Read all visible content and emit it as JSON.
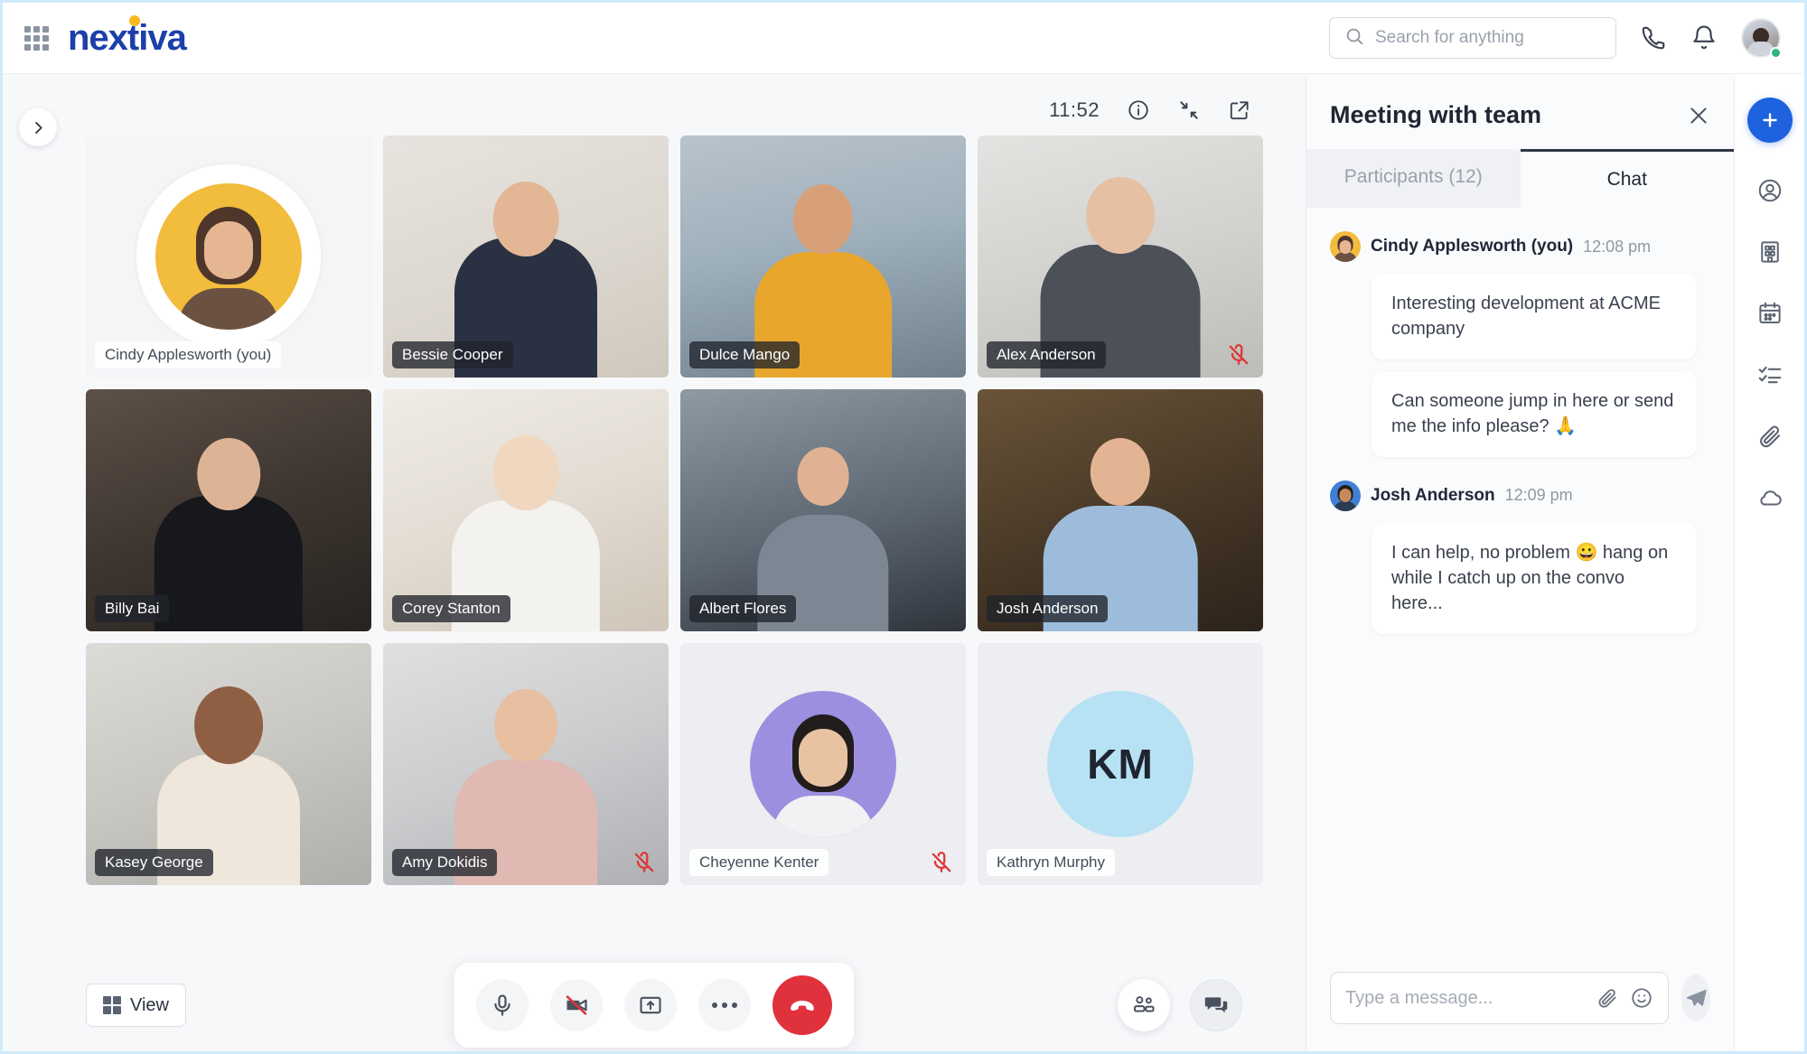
{
  "topbar": {
    "logo_text": "nextiva",
    "apps_icon": "grid-apps-icon",
    "search": {
      "placeholder": "Search for anything",
      "value": "",
      "icon": "search-icon"
    },
    "phone_icon": "phone-icon",
    "bell_icon": "bell-notification-icon",
    "avatar": {
      "name": "avatar",
      "status": "online"
    }
  },
  "stage": {
    "collapse_icon": "chevron-right-icon",
    "timer": "11:52",
    "info_icon": "info-circle-icon",
    "minimize_icon": "minimize-diagonal-icon",
    "popout_icon": "open-external-icon",
    "participants": [
      {
        "name": "Cindy Applesworth (you)",
        "kind": "self-avatar",
        "avatar_color": "#f2bc3d",
        "muted": false,
        "label_style": "light"
      },
      {
        "name": "Bessie Cooper",
        "kind": "video",
        "muted": false,
        "label_style": "dark"
      },
      {
        "name": "Dulce Mango",
        "kind": "video",
        "muted": false,
        "label_style": "dark"
      },
      {
        "name": "Alex Anderson",
        "kind": "video",
        "muted": true,
        "label_style": "dark"
      },
      {
        "name": "Billy Bai",
        "kind": "video",
        "muted": false,
        "label_style": "dark"
      },
      {
        "name": "Corey Stanton",
        "kind": "video",
        "muted": false,
        "label_style": "dark"
      },
      {
        "name": "Albert Flores",
        "kind": "video",
        "muted": false,
        "label_style": "dark"
      },
      {
        "name": "Josh Anderson",
        "kind": "video",
        "muted": false,
        "label_style": "dark"
      },
      {
        "name": "Kasey George",
        "kind": "video",
        "muted": false,
        "label_style": "dark"
      },
      {
        "name": "Amy Dokidis",
        "kind": "video",
        "muted": true,
        "label_style": "dark"
      },
      {
        "name": "Cheyenne Kenter",
        "kind": "avatar",
        "avatar_color": "#9d8fe0",
        "muted": true,
        "label_style": "light"
      },
      {
        "name": "Kathryn Murphy",
        "kind": "initials",
        "initials": "KM",
        "avatar_color": "#b6e2f4",
        "muted": false,
        "label_style": "light"
      }
    ]
  },
  "controls": {
    "view_label": "View",
    "view_icon": "grid-view-icon",
    "mic_icon": "microphone-icon",
    "camera_icon": "camera-off-icon",
    "share_icon": "share-screen-icon",
    "more_icon": "more-options-icon",
    "end_icon": "end-call-icon",
    "participants_icon": "participants-icon",
    "chat_icon": "chat-bubbles-icon",
    "end_call_color": "#e0323c"
  },
  "panel": {
    "title": "Meeting with team",
    "close_icon": "close-icon",
    "tabs": [
      {
        "label": "Participants (12)",
        "active": false
      },
      {
        "label": "Chat",
        "active": true
      }
    ],
    "messages": [
      {
        "author": "Cindy Applesworth (you)",
        "time": "12:08 pm",
        "avatar_color": "#f2bc3d",
        "bubbles": [
          "Interesting development at ACME company",
          "Can someone jump in here or send me the info please? 🙏"
        ]
      },
      {
        "author": "Josh Anderson",
        "time": "12:09 pm",
        "avatar_color": "#3f7fd6",
        "bubbles": [
          "I can help, no problem 😀 hang on while I catch up on the convo here..."
        ]
      }
    ],
    "composer": {
      "placeholder": "Type a message...",
      "value": "",
      "attach_icon": "paperclip-icon",
      "emoji_icon": "emoji-smiley-icon",
      "send_icon": "send-paper-plane-icon"
    }
  },
  "rail": {
    "add_icon": "plus-icon",
    "items": [
      {
        "icon": "contacts-icon"
      },
      {
        "icon": "building-icon"
      },
      {
        "icon": "calendar-icon"
      },
      {
        "icon": "tasks-list-icon"
      },
      {
        "icon": "attachments-icon"
      },
      {
        "icon": "cloud-icon"
      }
    ]
  },
  "theme": {
    "accent": "#1f62e0",
    "brand": "#1c3faa",
    "danger": "#e0323c",
    "online": "#2fb67c"
  }
}
